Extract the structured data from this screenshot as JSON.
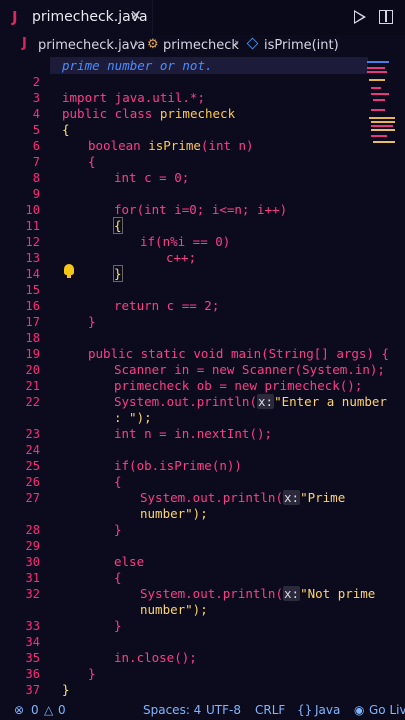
{
  "tab": {
    "icon": "J",
    "title": "primecheck.java",
    "close": "✕"
  },
  "breadcrumb": {
    "file": "primecheck.java",
    "class": "primecheck",
    "method": "isPrime(int)"
  },
  "first_line_comment": "prime number or not.",
  "line_numbers": [
    "2",
    "3",
    "4",
    "5",
    "6",
    "7",
    "8",
    "9",
    "10",
    "11",
    "12",
    "13",
    "14",
    "15",
    "16",
    "17",
    "18",
    "19",
    "20",
    "21",
    "22",
    "23",
    "24",
    "25",
    "26",
    "27",
    "28",
    "29",
    "30",
    "31",
    "32",
    "33",
    "34",
    "35",
    "36",
    "37"
  ],
  "code": {
    "l3": "import java.util.*;",
    "l4_kw": "public class",
    "l4_name": "primecheck",
    "l5": "{",
    "l6_type": "boolean",
    "l6_fn": "isPrime",
    "l6_args": "(int n)",
    "l7": "{",
    "l8": "int c = 0;",
    "l10": "for(int i=0; i<=n; i++)",
    "l11": "{",
    "l12": "if(n%i == 0)",
    "l13": "c++;",
    "l14": "}",
    "l16": "return c == 2;",
    "l17": "}",
    "l19": "public static void main(String[] args) {",
    "l20": "Scanner in = new Scanner(System.in);",
    "l21": "primecheck ob = new primecheck();",
    "l22a": "System.out.println(",
    "hint": "x:",
    "l22b": "\"Enter a number",
    "l22c": ": \");",
    "l23": "int n = in.nextInt();",
    "l25": "if(ob.isPrime(n))",
    "l26": "{",
    "l27a": "System.out.println(",
    "l27b": "\"Prime",
    "l27c": "number\");",
    "l28": "}",
    "l30": "else",
    "l31": "{",
    "l32a": "System.out.println(",
    "l32b": "\"Not prime",
    "l32c": "number\");",
    "l33": "}",
    "l35": "in.close();",
    "l36": "}",
    "l37": "}"
  },
  "status": {
    "errors": "0",
    "warnings": "0",
    "spaces": "Spaces: 4",
    "encoding": "UTF-8",
    "eol": "CRLF",
    "language": "Java",
    "golive": "Go Live"
  }
}
